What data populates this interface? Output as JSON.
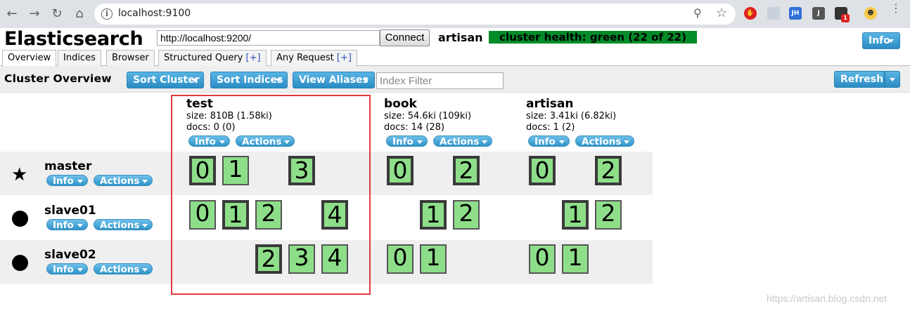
{
  "browser": {
    "url": "localhost:9100",
    "extension_labels": [
      "JH",
      "J",
      "1"
    ]
  },
  "app": {
    "title": "Elasticsearch",
    "connect_url": "http://localhost:9200/",
    "connect_label": "Connect",
    "cluster_name": "artisan",
    "cluster_health": "cluster health: green (22 of 22)",
    "info_label": "Info",
    "health_color": "#008c29"
  },
  "tabs": [
    {
      "label": "Overview",
      "plus": ""
    },
    {
      "label": "Indices",
      "plus": ""
    },
    {
      "label": "Browser",
      "plus": ""
    },
    {
      "label": "Structured Query ",
      "plus": "[+]"
    },
    {
      "label": "Any Request ",
      "plus": "[+]"
    }
  ],
  "toolbar": {
    "title": "Cluster Overview",
    "sort_cluster": "Sort Cluster",
    "sort_indices": "Sort Indices",
    "view_aliases": "View Aliases",
    "filter_placeholder": "Index Filter",
    "refresh": "Refresh"
  },
  "indices": [
    {
      "name": "test",
      "size": "size: 810B (1.58ki)",
      "docs": "docs: 0 (0)",
      "info": "Info",
      "actions": "Actions"
    },
    {
      "name": "book",
      "size": "size: 54.6ki (109ki)",
      "docs": "docs: 14 (28)",
      "info": "Info",
      "actions": "Actions"
    },
    {
      "name": "artisan",
      "size": "size: 3.41ki (6.82ki)",
      "docs": "docs: 1 (2)",
      "info": "Info",
      "actions": "Actions"
    }
  ],
  "nodes": [
    {
      "name": "master",
      "marker": "star",
      "info": "Info",
      "actions": "Actions"
    },
    {
      "name": "slave01",
      "marker": "dot",
      "info": "Info",
      "actions": "Actions"
    },
    {
      "name": "slave02",
      "marker": "dot",
      "info": "Info",
      "actions": "Actions"
    }
  ],
  "shards": {
    "master": {
      "test": [
        "0",
        "1",
        "",
        "3",
        ""
      ],
      "book": [
        "0",
        "",
        "2"
      ],
      "artisan": [
        "0",
        "",
        "2"
      ]
    },
    "slave01": {
      "test": [
        "0",
        "1",
        "2",
        "",
        "4"
      ],
      "book": [
        "",
        "1",
        "2"
      ],
      "artisan": [
        "",
        "1",
        "2"
      ]
    },
    "slave02": {
      "test": [
        "",
        "",
        "2",
        "3",
        "4"
      ],
      "book": [
        "0",
        "1",
        ""
      ],
      "artisan": [
        "0",
        "1",
        ""
      ]
    }
  },
  "shard_fill": "#8ede89",
  "watermark": "https://artisan.blog.csdn.net"
}
